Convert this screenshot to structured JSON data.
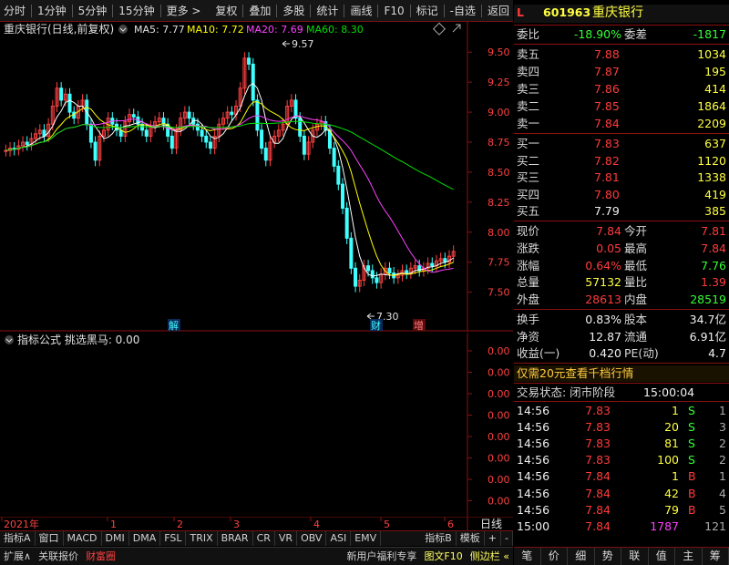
{
  "toolbar": {
    "items": [
      "分时",
      "1分钟",
      "5分钟",
      "15分钟",
      "更多 >"
    ],
    "right": [
      "复权",
      "叠加",
      "多股",
      "统计",
      "画线",
      "F10",
      "标记",
      "-自选",
      "返回"
    ]
  },
  "chart": {
    "title": "重庆银行(日线,前复权)",
    "ma5": "MA5: 7.77",
    "ma10": "MA10: 7.72",
    "ma20": "MA20: 7.69",
    "ma60": "MA60: 8.30",
    "high_label": "9.57",
    "low_label": "7.30",
    "y_ticks": [
      "9.50",
      "9.25",
      "9.00",
      "8.75",
      "8.50",
      "8.25",
      "8.00",
      "7.75",
      "7.50"
    ],
    "markers": [
      "解",
      "财",
      "增"
    ],
    "colors": {
      "ma5": "#ffffff",
      "ma10": "#ffff00",
      "ma20": "#ff40ff",
      "ma60": "#00e000",
      "up": "#ff4040",
      "down": "#40ffff"
    }
  },
  "indicator": {
    "title": "指标公式 挑选黑马: 0.00",
    "y_ticks": [
      "0.00",
      "0.00",
      "0.00",
      "0.00",
      "0.00",
      "0.00",
      "0.00",
      "0.00"
    ]
  },
  "xaxis": {
    "labels": [
      "2021年",
      "1",
      "2",
      "3",
      "4",
      "5",
      "6"
    ],
    "period": "日线"
  },
  "tabs": [
    "指标A",
    "窗口",
    "MACD",
    "DMI",
    "DMA",
    "FSL",
    "TRIX",
    "BRAR",
    "CR",
    "VR",
    "OBV",
    "ASI",
    "EMV",
    "指标B",
    "模板",
    "+",
    "-"
  ],
  "bottom": {
    "left": [
      "扩展∧",
      "关联报价",
      "财富圈"
    ],
    "right": [
      "新用户福利专享",
      "图文F10",
      "侧边栏 «"
    ]
  },
  "quote": {
    "code": "601963",
    "name": "重庆银行",
    "flag": "L",
    "weibi": {
      "label": "委比",
      "value": "-18.90%",
      "label2": "委差",
      "value2": "-1817"
    },
    "asks": [
      {
        "label": "卖五",
        "price": "7.88",
        "vol": "1034"
      },
      {
        "label": "卖四",
        "price": "7.87",
        "vol": "195"
      },
      {
        "label": "卖三",
        "price": "7.86",
        "vol": "414"
      },
      {
        "label": "卖二",
        "price": "7.85",
        "vol": "1864"
      },
      {
        "label": "卖一",
        "price": "7.84",
        "vol": "2209"
      }
    ],
    "bids": [
      {
        "label": "买一",
        "price": "7.83",
        "vol": "637"
      },
      {
        "label": "买二",
        "price": "7.82",
        "vol": "1120"
      },
      {
        "label": "买三",
        "price": "7.81",
        "vol": "1338"
      },
      {
        "label": "买四",
        "price": "7.80",
        "vol": "419"
      },
      {
        "label": "买五",
        "price": "7.79",
        "vol": "385"
      }
    ],
    "stats": [
      {
        "l1": "现价",
        "v1": "7.84",
        "l2": "今开",
        "v2": "7.81"
      },
      {
        "l1": "涨跌",
        "v1": "0.05",
        "l2": "最高",
        "v2": "7.84"
      },
      {
        "l1": "涨幅",
        "v1": "0.64%",
        "l2": "最低",
        "v2": "7.76"
      },
      {
        "l1": "总量",
        "v1": "57132",
        "l2": "量比",
        "v2": "1.39"
      },
      {
        "l1": "外盘",
        "v1": "28613",
        "l2": "内盘",
        "v2": "28519"
      }
    ],
    "fund": [
      {
        "l1": "换手",
        "v1": "0.83%",
        "l2": "股本",
        "v2": "34.7亿"
      },
      {
        "l1": "净资",
        "v1": "12.87",
        "l2": "流通",
        "v2": "6.91亿"
      },
      {
        "l1": "收益(一)",
        "v1": "0.420",
        "l2": "PE(动)",
        "v2": "4.7"
      }
    ],
    "promo": "仅需20元查看千档行情",
    "status": {
      "label": "交易状态: 闭市阶段",
      "time": "15:00:04"
    },
    "ticks": [
      {
        "t": "14:56",
        "p": "7.83",
        "v": "1",
        "s": "S",
        "n": "1"
      },
      {
        "t": "14:56",
        "p": "7.83",
        "v": "20",
        "s": "S",
        "n": "3"
      },
      {
        "t": "14:56",
        "p": "7.83",
        "v": "81",
        "s": "S",
        "n": "2"
      },
      {
        "t": "14:56",
        "p": "7.83",
        "v": "100",
        "s": "S",
        "n": "2"
      },
      {
        "t": "14:56",
        "p": "7.84",
        "v": "1",
        "s": "B",
        "n": "1"
      },
      {
        "t": "14:56",
        "p": "7.84",
        "v": "42",
        "s": "B",
        "n": "4"
      },
      {
        "t": "14:56",
        "p": "7.84",
        "v": "79",
        "s": "B",
        "n": "5"
      },
      {
        "t": "15:00",
        "p": "7.84",
        "v": "1787",
        "s": "",
        "n": "121"
      }
    ],
    "tabs": [
      "笔",
      "价",
      "细",
      "势",
      "联",
      "值",
      "主",
      "筹"
    ]
  }
}
